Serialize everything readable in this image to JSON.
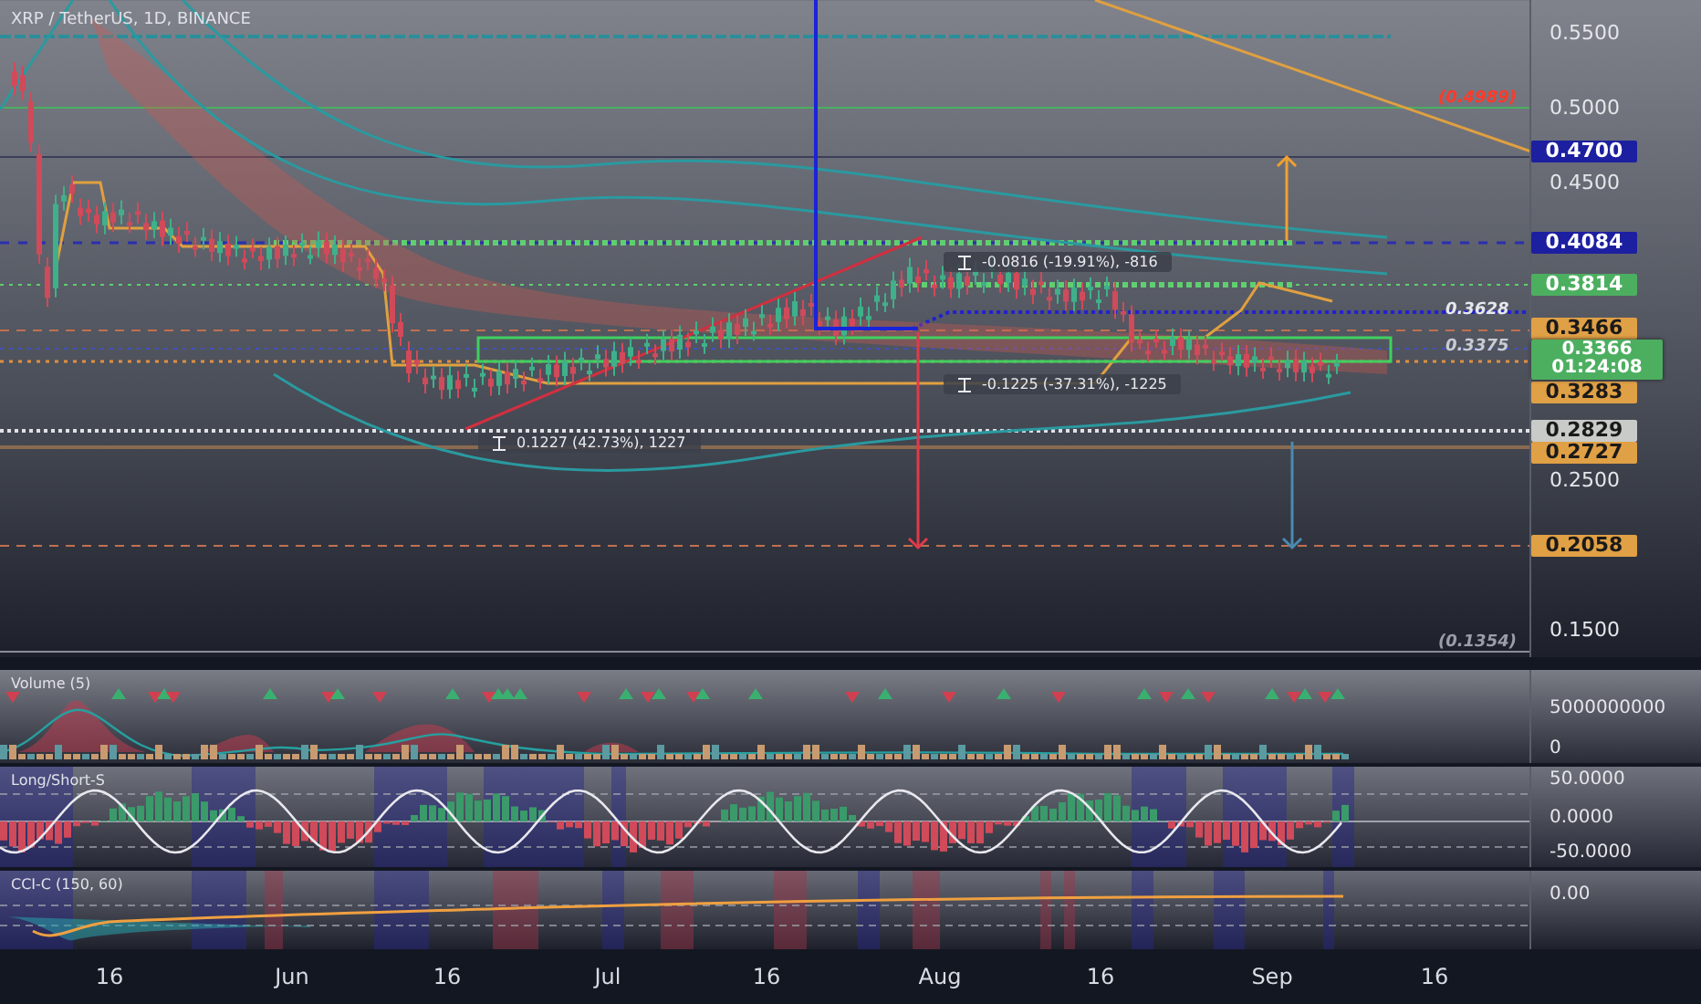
{
  "legend": {
    "symbol": "XRP / TetherUS, 1D, BINANCE"
  },
  "price_axis": {
    "ticks": [
      "0.5500",
      "0.5000",
      "0.4500",
      "0.2500",
      "0.1500"
    ]
  },
  "price_labels": [
    {
      "text": "0.4700",
      "color": "#1c1fa0"
    },
    {
      "text": "0.4084",
      "color": "#1c1fa0"
    },
    {
      "text": "0.3814",
      "color": "#4caf60"
    },
    {
      "text": "0.3466",
      "color": "#e0a045"
    },
    {
      "text": "0.3366",
      "countdown": "01:24:08",
      "color": "#4caf60"
    },
    {
      "text": "0.3283",
      "color": "#e0a045"
    },
    {
      "text": "0.2829",
      "color": "#c8cbc8"
    },
    {
      "text": "0.2727",
      "color": "#e0a045"
    },
    {
      "text": "0.2058",
      "color": "#e0a045"
    }
  ],
  "line_labels": [
    {
      "text": "(0.4989)",
      "color": "#ff3a2a"
    },
    {
      "text": "0.3628",
      "color": "#e6e8ee"
    },
    {
      "text": "0.3375",
      "color": "#c9ccd4"
    },
    {
      "text": "(0.1354)",
      "color": "#9a9ea8"
    }
  ],
  "measurements": [
    {
      "text": "-0.0816 (-19.91%), -816"
    },
    {
      "text": "-0.1225 (-37.31%), -1225"
    },
    {
      "text": "0.1227 (42.73%), 1227"
    }
  ],
  "indicators": [
    {
      "kind": "volume",
      "title": "Volume (5)",
      "axis": [
        "5000000000",
        "0"
      ]
    },
    {
      "kind": "oscillator",
      "title": "Long/Short-S",
      "axis": [
        "50.0000",
        "0.0000",
        "-50.0000"
      ]
    },
    {
      "kind": "cci",
      "title": "CCI-C (150, 60)",
      "axis": [
        "0.00"
      ]
    }
  ],
  "time_axis": [
    "16",
    "Jun",
    "16",
    "Jul",
    "16",
    "Aug",
    "16",
    "Sep",
    "16"
  ]
}
